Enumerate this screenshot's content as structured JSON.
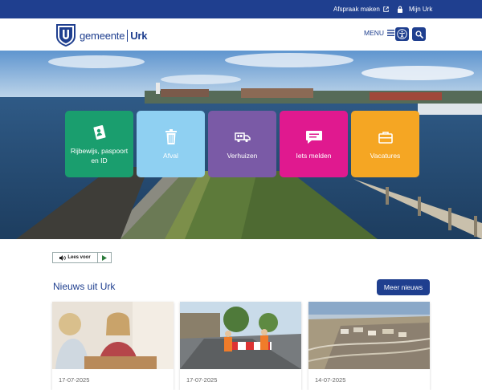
{
  "topbar": {
    "appointment_label": "Afspraak maken",
    "mijn_label": "Mijn Urk"
  },
  "header": {
    "logo_prefix": "gemeente",
    "logo_name": "Urk",
    "menu_label": "MENU"
  },
  "tiles": [
    {
      "label": "Rijbewijs, paspoort en ID",
      "icon": "id-card-icon",
      "color": "#1a9e6e"
    },
    {
      "label": "Afval",
      "icon": "trash-icon",
      "color": "#8fd0f2"
    },
    {
      "label": "Verhuizen",
      "icon": "moving-truck-icon",
      "color": "#7a5aa6"
    },
    {
      "label": "Iets melden",
      "icon": "chat-icon",
      "color": "#e0198f"
    },
    {
      "label": "Vacatures",
      "icon": "briefcase-icon",
      "color": "#f5a623"
    }
  ],
  "readspeaker": {
    "label": "Lees voor"
  },
  "news": {
    "title": "Nieuws uit Urk",
    "more_label": "Meer nieuws",
    "items": [
      {
        "date": "17-07-2025"
      },
      {
        "date": "17-07-2025"
      },
      {
        "date": "14-07-2025"
      }
    ]
  },
  "colors": {
    "brand": "#1f3f8f"
  }
}
